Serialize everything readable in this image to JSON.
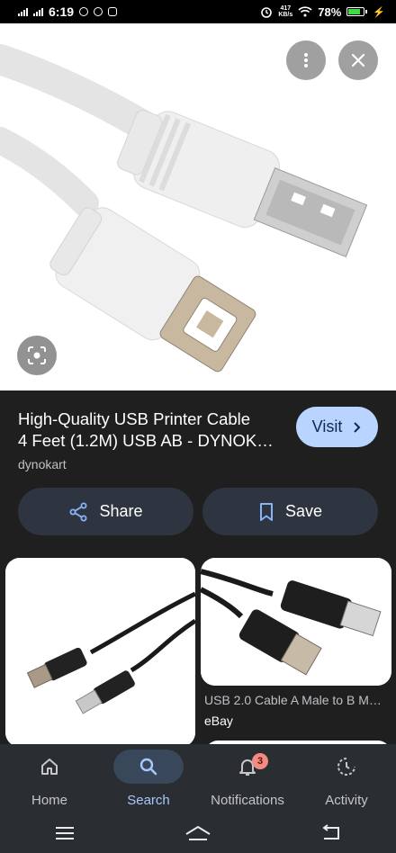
{
  "status_bar": {
    "time": "6:19",
    "net_speed_value": "417",
    "net_speed_unit": "KB/s",
    "battery": "78%",
    "battery_level": 0.78,
    "battery_color": "#3ddc44"
  },
  "preview": {
    "image_icon": "usb-cable-photo",
    "more_icon": "more-vert-icon",
    "close_icon": "close-icon",
    "lens_icon": "lens-icon"
  },
  "result": {
    "title_line1": "High-Quality USB Printer Cable",
    "title_line2": "4 Feet (1.2M) USB AB - DYNOK…",
    "source": "dynokart",
    "visit_label": "Visit",
    "share_label": "Share",
    "save_label": "Save"
  },
  "related": [
    {
      "caption": "",
      "source": ""
    },
    {
      "caption": "USB 2.0 Cable A Male to B M…",
      "source": "eBay"
    }
  ],
  "bottom_nav": {
    "items": [
      {
        "label": "Home",
        "icon": "home-icon"
      },
      {
        "label": "Search",
        "icon": "search-icon",
        "active": true
      },
      {
        "label": "Notifications",
        "icon": "bell-icon",
        "badge": "3"
      },
      {
        "label": "Activity",
        "icon": "activity-icon"
      }
    ]
  },
  "colors": {
    "accent": "#b8d4ff",
    "background": "#1f1f1f",
    "active_nav": "#a8c7fa",
    "badge": "#f28b82"
  }
}
